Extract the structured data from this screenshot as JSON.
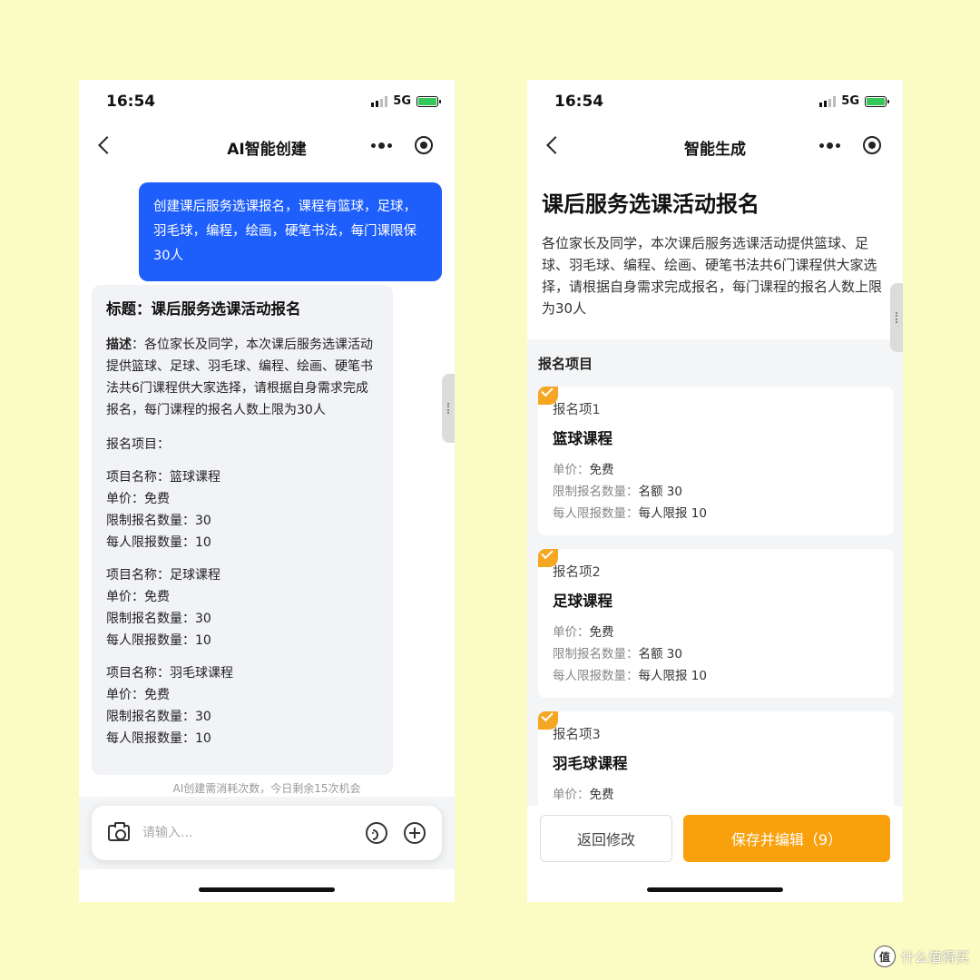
{
  "left_phone": {
    "status": {
      "time": "16:54",
      "network": "5G"
    },
    "nav_title": "AI智能创建",
    "user_message": "创建课后服务选课报名，课程有篮球，足球，羽毛球，编程，绘画，硬笔书法，每门课限保30人",
    "ai_reply": {
      "title": "标题：课后服务选课活动报名",
      "desc_label": "描述",
      "desc_text": "：各位家长及同学，本次课后服务选课活动提供篮球、足球、羽毛球、编程、绘画、硬笔书法共6门课程供大家选择，请根据自身需求完成报名，每门课程的报名人数上限为30人",
      "section": "报名项目：",
      "items": [
        {
          "name": "项目名称：篮球课程",
          "price": "单价：免费",
          "limit": "限制报名数量：30",
          "per_person": "每人限报数量：10"
        },
        {
          "name": "项目名称：足球课程",
          "price": "单价：免费",
          "limit": "限制报名数量：30",
          "per_person": "每人限报数量：10"
        },
        {
          "name": "项目名称：羽毛球课程",
          "price": "单价：免费",
          "limit": "限制报名数量：30",
          "per_person": "每人限报数量：10"
        }
      ]
    },
    "quota_tip": "AI创建需消耗次数，今日剩余15次机会",
    "input_placeholder": "请输入..."
  },
  "right_phone": {
    "status": {
      "time": "16:54",
      "network": "5G"
    },
    "nav_title": "智能生成",
    "form_title": "课后服务选课活动报名",
    "form_desc": "各位家长及同学，本次课后服务选课活动提供篮球、足球、羽毛球、编程、绘画、硬笔书法共6门课程供大家选择，请根据自身需求完成报名，每门课程的报名人数上限为30人",
    "section_label": "报名项目",
    "labels": {
      "price": "单价：",
      "limit": "限制报名数量：",
      "per_person": "每人限报数量："
    },
    "items": [
      {
        "num": "报名项1",
        "name": "篮球课程",
        "price": "免费",
        "limit": "名额 30",
        "per_person": "每人限报 10"
      },
      {
        "num": "报名项2",
        "name": "足球课程",
        "price": "免费",
        "limit": "名额 30",
        "per_person": "每人限报 10"
      },
      {
        "num": "报名项3",
        "name": "羽毛球课程",
        "price": "免费"
      }
    ],
    "buttons": {
      "back_edit": "返回修改",
      "save_edit": "保存并编辑（9）"
    }
  },
  "watermark": {
    "logo_char": "值",
    "text": "什么值得买"
  },
  "colors": {
    "background": "#fbfcc4",
    "user_bubble": "#1e5efb",
    "accent_orange": "#f8a10d",
    "check_badge": "#f5a623"
  },
  "icons": [
    "back-icon",
    "more-icon",
    "target-icon",
    "camera-icon",
    "voice-icon",
    "plus-icon",
    "check-icon",
    "battery-icon",
    "signal-icon"
  ]
}
